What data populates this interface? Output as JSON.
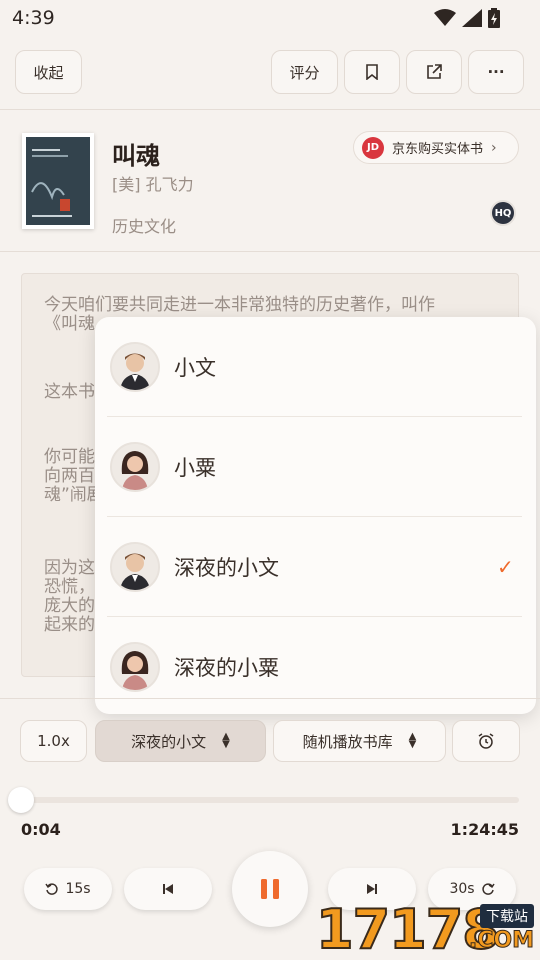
{
  "status": {
    "time": "4:39"
  },
  "header": {
    "collapse_label": "收起",
    "rate_label": "评分",
    "bookmark_icon": "bookmark-icon",
    "share_icon": "share-icon",
    "more_label": "···"
  },
  "book": {
    "title": "叫魂",
    "author": "[美] 孔飞力",
    "category": "历史文化",
    "jd_badge": "JD",
    "jd_label": "京东购买实体书",
    "hq_badge": "HQ"
  },
  "text_panel": {
    "paragraphs": [
      "今天咱们要共同走进一本非常独特的历史著作，叫作\n《叫魂",
      "这本书",
      "你可能\n向两百\n魂”闹剧",
      "因为这\n恐慌，\n庞大的\n起来的"
    ]
  },
  "voice_menu": {
    "items": [
      {
        "label": "小文",
        "avatar": "male-avatar",
        "selected": false
      },
      {
        "label": "小粟",
        "avatar": "female-avatar",
        "selected": false
      },
      {
        "label": "深夜的小文",
        "avatar": "male-avatar",
        "selected": true
      },
      {
        "label": "深夜的小粟",
        "avatar": "female-avatar",
        "selected": false
      }
    ],
    "check_mark": "✓"
  },
  "controls": {
    "speed_label": "1.0x",
    "voice_label": "深夜的小文",
    "playlist_label": "随机播放书库",
    "timer_icon": "alarm-icon"
  },
  "playback": {
    "progress": 0.0085,
    "elapsed": "0:04",
    "duration": "1:24:45",
    "rewind_label": "15s",
    "forward_label": "30s"
  },
  "watermark": {
    "number": "17178",
    "top_text": "下载站",
    "domain": ".COM"
  },
  "colors": {
    "accent": "#ef6a2c",
    "jd_red": "#d9363e",
    "background": "#f6f2ee"
  }
}
